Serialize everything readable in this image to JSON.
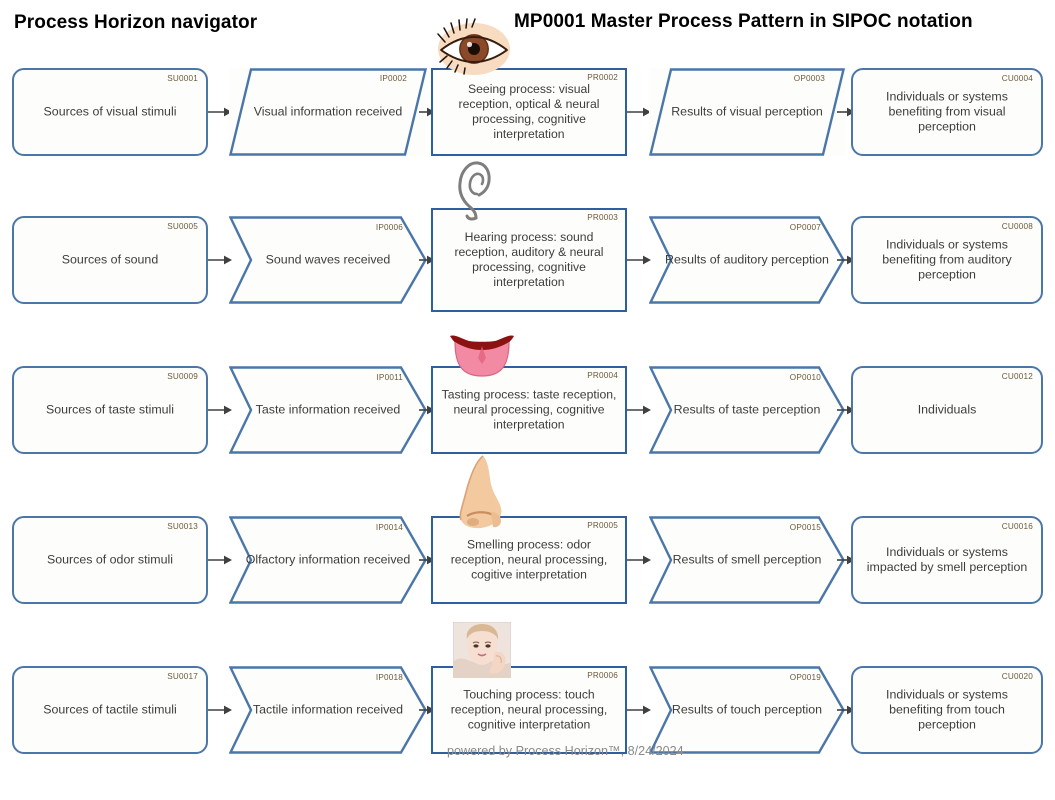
{
  "header": {
    "left_title": "Process Horizon navigator",
    "right_title": "MP0001 Master Process Pattern in SIPOC notation"
  },
  "footer": {
    "text": "powered by Process Horizon™, 8/24/2024"
  },
  "colors": {
    "supplier_border": "#4a76a8",
    "input_border": "#4a76a8",
    "process_border": "#2e5f9e",
    "output_border": "#4a76a8",
    "customer_border": "#4a76a8",
    "shape_fill": "#fdfdfb",
    "code_text": "#6a5a3a",
    "body_text": "#3d3d3d",
    "arrow": "#404040",
    "footer_text": "#8a8a8a"
  },
  "column_kinds": [
    "supplier",
    "input",
    "process",
    "output",
    "customer"
  ],
  "rows": [
    {
      "sense": "sight",
      "icon": "eye-icon",
      "input_shape": "parallelogram",
      "output_shape": "parallelogram",
      "supplier": {
        "code": "SU0001",
        "label": "Sources of visual stimuli"
      },
      "input": {
        "code": "IP0002",
        "label": "Visual information received"
      },
      "process": {
        "code": "PR0002",
        "label": "Seeing process: visual reception, optical & neural processing, cognitive interpretation"
      },
      "output": {
        "code": "OP0003",
        "label": "Results of visual perception"
      },
      "customer": {
        "code": "CU0004",
        "label": "Individuals or systems benefiting from visual perception"
      }
    },
    {
      "sense": "hearing",
      "icon": "ear-icon",
      "input_shape": "chevron",
      "output_shape": "chevron",
      "supplier": {
        "code": "SU0005",
        "label": "Sources of sound"
      },
      "input": {
        "code": "IP0006",
        "label": "Sound waves received"
      },
      "process": {
        "code": "PR0003",
        "label": "Hearing process: sound reception, auditory & neural processing, cognitive interpretation"
      },
      "output": {
        "code": "OP0007",
        "label": "Results of auditory perception"
      },
      "customer": {
        "code": "CU0008",
        "label": "Individuals or systems benefiting from auditory perception"
      }
    },
    {
      "sense": "taste",
      "icon": "tongue-icon",
      "input_shape": "chevron",
      "output_shape": "chevron",
      "supplier": {
        "code": "SU0009",
        "label": "Sources of taste stimuli"
      },
      "input": {
        "code": "IP0011",
        "label": "Taste information received"
      },
      "process": {
        "code": "PR0004",
        "label": "Tasting process: taste reception, neural processing, cognitive interpretation"
      },
      "output": {
        "code": "OP0010",
        "label": "Results of taste perception"
      },
      "customer": {
        "code": "CU0012",
        "label": "Individuals"
      }
    },
    {
      "sense": "smell",
      "icon": "nose-icon",
      "input_shape": "chevron",
      "output_shape": "chevron",
      "supplier": {
        "code": "SU0013",
        "label": "Sources of odor stimuli"
      },
      "input": {
        "code": "IP0014",
        "label": "Olfactory information received"
      },
      "process": {
        "code": "PR0005",
        "label": "Smelling process: odor reception, neural processing, cogitive interpretation"
      },
      "output": {
        "code": "OP0015",
        "label": "Results of smell perception"
      },
      "customer": {
        "code": "CU0016",
        "label": "Individuals or systems impacted by smell perception"
      }
    },
    {
      "sense": "touch",
      "icon": "touch-face-icon",
      "input_shape": "chevron",
      "output_shape": "chevron",
      "supplier": {
        "code": "SU0017",
        "label": "Sources of tactile stimuli"
      },
      "input": {
        "code": "IP0018",
        "label": "Tactile information received"
      },
      "process": {
        "code": "PR0006",
        "label": "Touching process: touch reception, neural processing, cognitive interpretation"
      },
      "output": {
        "code": "OP0019",
        "label": "Results of touch perception"
      },
      "customer": {
        "code": "CU0020",
        "label": "Individuals or systems benefiting from touch perception"
      }
    }
  ]
}
